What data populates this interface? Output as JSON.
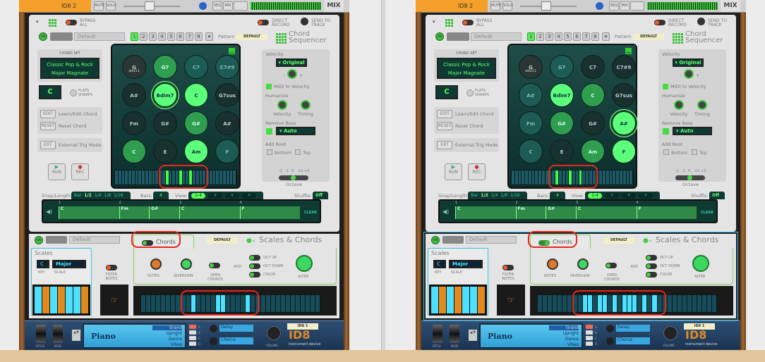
{
  "panels": [
    {
      "mixer": {
        "track_name": "ID8 2",
        "mute": "MUTE",
        "solo": "SOLO",
        "seq": "SEQ",
        "mix": "MIX",
        "mix_label": "MIX"
      },
      "chord_sequencer": {
        "bypass_label": "BYPASS ALL",
        "direct_record_label": "DIRECT RECORD",
        "send_to_track_label": "SEND TO TRACK",
        "on_label": "ON",
        "preset_name": "Default",
        "patterns": [
          "1",
          "2",
          "3",
          "4",
          "5",
          "6",
          "7",
          "8"
        ],
        "selected_pattern": "1",
        "pattern_label": "Pattern",
        "pattern_name": "DEFAULT",
        "logo_line1": "Chord",
        "logo_line2": "Sequencer",
        "chord_set_label": "CHORD SET",
        "chord_set_line1": "Classic Pop & Rock",
        "chord_set_line2": "Major Magnate",
        "key": "C",
        "flats_sharps": "FLATS SHARPS",
        "edit": "EDIT",
        "edit_label": "Learn/Edit Chord",
        "reset": "RESET",
        "reset_label": "Reset Chord",
        "ext": "EXT",
        "ext_label": "External Trig Mode",
        "run": "RUN",
        "rec": "REC",
        "midi": "MIDI",
        "pads": [
          {
            "chord": "G",
            "sub": "add11",
            "state": "gray"
          },
          {
            "chord": "G7",
            "state": "mid"
          },
          {
            "chord": "C7",
            "state": "teal"
          },
          {
            "chord": "C7#9",
            "state": "teal"
          },
          {
            "chord": "A#",
            "state": "dark"
          },
          {
            "chord": "Bdim7",
            "state": "bright",
            "selected": true
          },
          {
            "chord": "C",
            "state": "bright"
          },
          {
            "chord": "G7sus",
            "state": "dark"
          },
          {
            "chord": "Fm",
            "state": "dark"
          },
          {
            "chord": "G#",
            "state": "dark"
          },
          {
            "chord": "G#",
            "state": "mid"
          },
          {
            "chord": "A#",
            "state": "dark"
          },
          {
            "chord": "C",
            "state": "mid"
          },
          {
            "chord": "E",
            "state": "dark"
          },
          {
            "chord": "Am",
            "state": "bright"
          },
          {
            "chord": "F",
            "state": "teal"
          }
        ],
        "keyboard_active_white_keys": [
          15,
          19,
          22
        ],
        "velocity_label": "Velocity",
        "velocity_mode": "Original",
        "minus": "-",
        "plus": "+",
        "midi_to_velocity": "MIDI to Velocity",
        "humanize_label": "Humanize",
        "hum_velocity": "Velocity",
        "hum_timing": "Timing",
        "remove_bass_label": "Remove Bass",
        "remove_bass_mode": "Auto",
        "add_root_label": "Add Root",
        "bottom": "Bottom",
        "top": "Top",
        "octave_ticks": [
          "-2",
          "-1",
          "0",
          "+1",
          "+2"
        ],
        "octave_label": "Octave",
        "octave_value": 0,
        "snap_label": "Snap/Length:",
        "snap_options": [
          "Bar",
          "1/2",
          "1/4",
          "1/8",
          "1/16"
        ],
        "snap_selected": "1/2",
        "bars_label": "Bars:",
        "bars_value": "4",
        "view_label": "View:",
        "view_options": [
          "1-4",
          "+",
          "+",
          "+"
        ],
        "shuffle_label": "Shuffle:",
        "shuffle_value": "Off",
        "bar_numbers": [
          "1",
          "2",
          "3",
          "4"
        ],
        "clips": [
          {
            "chord": "C",
            "start": 1,
            "length": 1
          },
          {
            "chord": "Fm",
            "start": 2,
            "length": 0.5
          },
          {
            "chord": "G#",
            "start": 2.5,
            "length": 0.5
          },
          {
            "chord": "C",
            "start": 3,
            "length": 1
          },
          {
            "chord": "F",
            "start": 4,
            "length": 1
          }
        ],
        "clear": "CLEAR"
      },
      "scales_chords": {
        "on_label": "ON",
        "preset_name": "Default",
        "chords_label": "Chords",
        "chords_enabled": false,
        "patch_name": "DEFAULT",
        "logo": "Scales & Chords",
        "scales_label": "Scales",
        "key": "C",
        "scale": "Major",
        "key_label": "KEY",
        "scale_label": "SCALE",
        "filter_notes": "FILTER NOTES",
        "notes": "NOTES",
        "inversion": "INVERSION",
        "open_chords": "OPEN CHORDS",
        "add_label": "ADD",
        "oct_up": "OCT UP",
        "oct_down": "OCT DOWN",
        "color": "COLOR",
        "alter": "ALTER",
        "keyboard_active_white_keys": [
          10,
          15,
          16,
          21
        ]
      },
      "id8": {
        "pitch": "PITCH",
        "mod": "MOD",
        "category": "Piano",
        "variants": [
          "Grand",
          "Upright",
          "Dance",
          "Vibes"
        ],
        "selected_variant": "Grand",
        "slots": [
          "A",
          "B",
          "C",
          "D"
        ],
        "fx1": "Delay",
        "fx2": "Chorus",
        "volume": "VOLUME",
        "name_tag": "ID8 1",
        "brand": "ID8",
        "brand_sub": "instrument device"
      }
    },
    {
      "mixer": {
        "track_name": "ID8 2",
        "mute": "MUTE",
        "solo": "SOLO",
        "seq": "SEQ",
        "mix": "MIX",
        "mix_label": "MIX"
      },
      "chord_sequencer": {
        "bypass_label": "BYPASS ALL",
        "direct_record_label": "DIRECT RECORD",
        "send_to_track_label": "SEND TO TRACK",
        "on_label": "ON",
        "preset_name": "Default",
        "patterns": [
          "1",
          "2",
          "3",
          "4",
          "5",
          "6",
          "7",
          "8"
        ],
        "selected_pattern": "1",
        "pattern_label": "Pattern",
        "pattern_name": "DEFAULT",
        "logo_line1": "Chord",
        "logo_line2": "Sequencer",
        "chord_set_label": "CHORD SET",
        "chord_set_line1": "Classic Pop & Rock",
        "chord_set_line2": "Major Magnate",
        "key": "C",
        "flats_sharps": "FLATS SHARPS",
        "edit": "EDIT",
        "edit_label": "Learn/Edit Chord",
        "reset": "RESET",
        "reset_label": "Reset Chord",
        "ext": "EXT",
        "ext_label": "External Trig Mode",
        "run": "RUN",
        "rec": "REC",
        "midi": "MIDI",
        "pads": [
          {
            "chord": "G",
            "sub": "add11",
            "state": "gray"
          },
          {
            "chord": "G7",
            "state": "teal"
          },
          {
            "chord": "C7",
            "state": "dark"
          },
          {
            "chord": "C7#9",
            "state": "dark"
          },
          {
            "chord": "A#",
            "state": "teal"
          },
          {
            "chord": "Bdim7",
            "state": "bright"
          },
          {
            "chord": "C",
            "state": "mid"
          },
          {
            "chord": "G7sus",
            "state": "dark"
          },
          {
            "chord": "Fm",
            "state": "teal"
          },
          {
            "chord": "G#",
            "state": "mid"
          },
          {
            "chord": "G#",
            "state": "dark"
          },
          {
            "chord": "A#",
            "state": "bright",
            "selected": true
          },
          {
            "chord": "C",
            "state": "teal"
          },
          {
            "chord": "E",
            "state": "dark"
          },
          {
            "chord": "Am",
            "state": "mid"
          },
          {
            "chord": "F",
            "state": "bright"
          }
        ],
        "keyboard_active_white_keys": [
          13,
          17,
          20
        ],
        "velocity_label": "Velocity",
        "velocity_mode": "Original",
        "minus": "-",
        "plus": "+",
        "midi_to_velocity": "MIDI to Velocity",
        "humanize_label": "Humanize",
        "hum_velocity": "Velocity",
        "hum_timing": "Timing",
        "remove_bass_label": "Remove Bass",
        "remove_bass_mode": "Auto",
        "add_root_label": "Add Root",
        "bottom": "Bottom",
        "top": "Top",
        "octave_ticks": [
          "-2",
          "-1",
          "0",
          "+1",
          "+2"
        ],
        "octave_label": "Octave",
        "octave_value": 0,
        "snap_label": "Snap/Length:",
        "snap_options": [
          "Bar",
          "1/2",
          "1/4",
          "1/8",
          "1/16"
        ],
        "snap_selected": "1/2",
        "bars_label": "Bars:",
        "bars_value": "4",
        "view_label": "View:",
        "view_options": [
          "1-4",
          "+",
          "+",
          "+"
        ],
        "shuffle_label": "Shuffle:",
        "shuffle_value": "Off",
        "bar_numbers": [
          "1",
          "2",
          "3",
          "4"
        ],
        "clips": [
          {
            "chord": "C",
            "start": 1,
            "length": 1
          },
          {
            "chord": "Fm",
            "start": 2,
            "length": 0.5
          },
          {
            "chord": "G#",
            "start": 2.5,
            "length": 0.5
          },
          {
            "chord": "C",
            "start": 3,
            "length": 1
          },
          {
            "chord": "F",
            "start": 4,
            "length": 1
          }
        ],
        "clear": "CLEAR"
      },
      "scales_chords": {
        "on_label": "ON",
        "preset_name": "Default",
        "chords_label": "Chords",
        "chords_enabled": true,
        "patch_name": "DEFAULT",
        "logo": "Scales & Chords",
        "scales_label": "Scales",
        "key": "C",
        "scale": "Major",
        "key_label": "KEY",
        "scale_label": "SCALE",
        "filter_notes": "FILTER NOTES",
        "notes": "NOTES",
        "inversion": "INVERSION",
        "open_chords": "OPEN CHORDS",
        "add_label": "ADD",
        "oct_up": "OCT UP",
        "oct_down": "OCT DOWN",
        "color": "COLOR",
        "alter": "ALTER",
        "keyboard_active_white_keys": [
          9,
          10,
          12,
          13,
          15,
          17,
          18,
          19,
          21,
          23
        ]
      },
      "id8": {
        "pitch": "PITCH",
        "mod": "MOD",
        "category": "Piano",
        "variants": [
          "Grand",
          "Upright",
          "Dance",
          "Vibes"
        ],
        "selected_variant": "Grand",
        "slots": [
          "A",
          "B",
          "C",
          "D"
        ],
        "fx1": "Delay",
        "fx2": "Chorus",
        "volume": "VOLUME",
        "name_tag": "ID8 1",
        "brand": "ID8",
        "brand_sub": "instrument device"
      }
    }
  ],
  "colors": {
    "accent_green": "#5cff7a",
    "selection_blue": "#39c3e6",
    "highlight_red": "#e8261c",
    "track_orange": "#f4a02a"
  }
}
